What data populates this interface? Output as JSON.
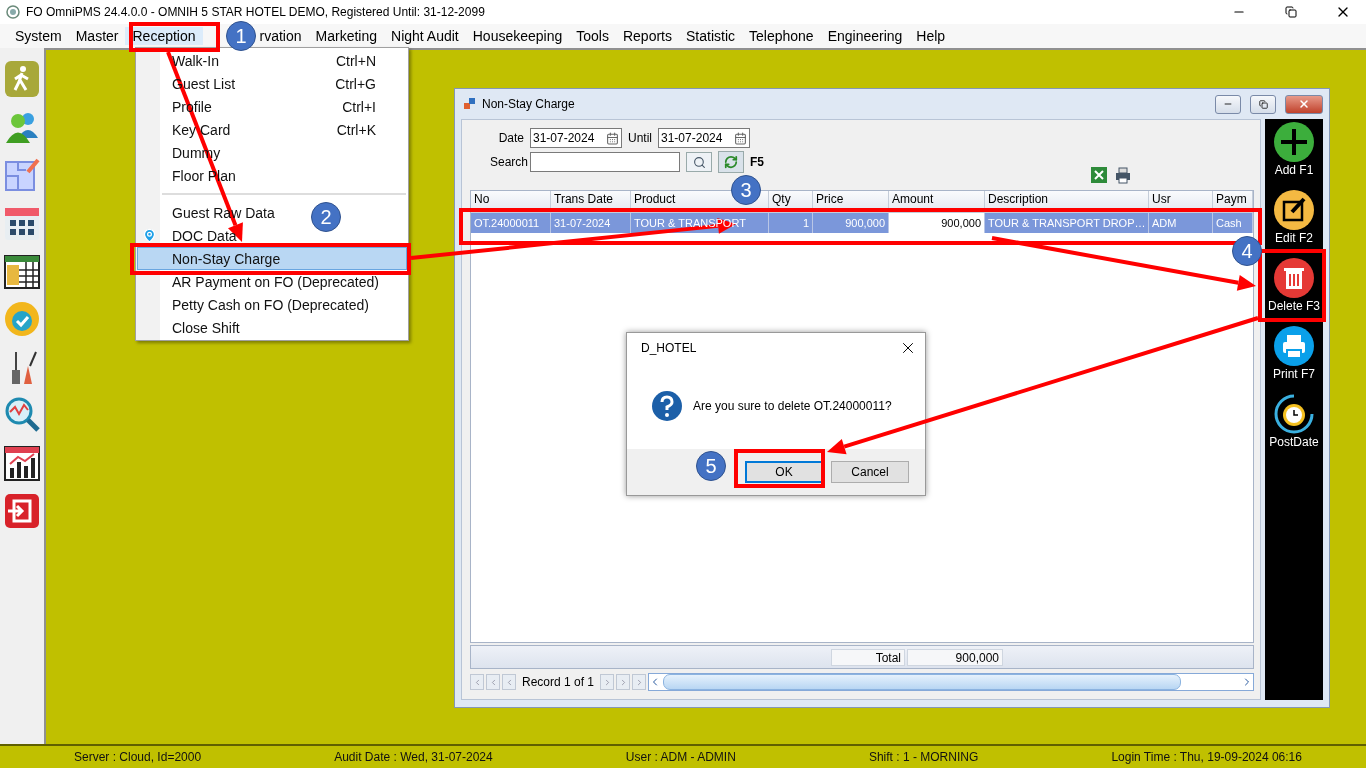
{
  "window": {
    "title": "FO OmniPMS 24.4.0.0 - OMNIH 5 STAR HOTEL DEMO, Registered Until: 31-12-2099"
  },
  "menu_bar": [
    {
      "label": "System",
      "selected": false
    },
    {
      "label": "Master",
      "selected": false
    },
    {
      "label": "Reception",
      "selected": true
    },
    {
      "label": "rvation",
      "selected": false
    },
    {
      "label": "Marketing",
      "selected": false
    },
    {
      "label": "Night Audit",
      "selected": false
    },
    {
      "label": "Housekeeping",
      "selected": false
    },
    {
      "label": "Tools",
      "selected": false
    },
    {
      "label": "Reports",
      "selected": false
    },
    {
      "label": "Statistic",
      "selected": false
    },
    {
      "label": "Telephone",
      "selected": false
    },
    {
      "label": "Engineering",
      "selected": false
    },
    {
      "label": "Help",
      "selected": false
    }
  ],
  "reception_menu": {
    "sections": [
      [
        {
          "label": "Walk-In",
          "shortcut": "Ctrl+N",
          "selected": false
        },
        {
          "label": "Guest List",
          "shortcut": "Ctrl+G",
          "selected": false
        },
        {
          "label": "Profile",
          "shortcut": "Ctrl+I",
          "selected": false
        },
        {
          "label": "Key Card",
          "shortcut": "Ctrl+K",
          "selected": false
        },
        {
          "label": "Dummy",
          "selected": false
        },
        {
          "label": "Floor Plan",
          "selected": false
        }
      ],
      [
        {
          "label": "Guest Raw Data",
          "selected": false
        },
        {
          "label": "DOC Data",
          "kind": "pin",
          "selected": false
        },
        {
          "label": "Non-Stay Charge",
          "selected": true
        },
        {
          "label": "AR Payment on FO (Deprecated)",
          "selected": false
        },
        {
          "label": "Petty Cash on FO (Deprecated)",
          "selected": false
        },
        {
          "label": "Close Shift",
          "selected": false
        }
      ]
    ]
  },
  "non_stay_window": {
    "title": "Non-Stay Charge",
    "date_label": "Date",
    "date": "31-07-2024",
    "until_label": "Until",
    "until": "31-07-2024",
    "search_label": "Search",
    "refresh_key": "F5",
    "table": {
      "columns": [
        "No",
        "Trans Date",
        "Product",
        "Qty",
        "Price",
        "Amount",
        "Description",
        "Usr",
        "Paym"
      ],
      "rows": [
        {
          "cells": [
            "OT.24000011",
            "31-07-2024",
            "TOUR & TRANSPORT",
            "1",
            "900,000",
            "900,000",
            "TOUR & TRANSPORT DROP…",
            "ADM",
            "Cash"
          ],
          "selected": true
        }
      ]
    },
    "total_label": "Total",
    "total": "900,000",
    "record": "Record 1 of 1"
  },
  "toolbar": [
    {
      "label": "Add F1",
      "kind": "add"
    },
    {
      "label": "Edit F2",
      "kind": "edit"
    },
    {
      "label": "Delete F3",
      "kind": "delete"
    },
    {
      "label": "Print F7",
      "kind": "print"
    },
    {
      "label": "PostDate",
      "kind": "postdate"
    }
  ],
  "dialog": {
    "title": "D_HOTEL",
    "message": "Are you sure to delete OT.24000011?",
    "buttons": [
      {
        "label": "OK",
        "selected": true
      },
      {
        "label": "Cancel",
        "selected": false
      }
    ]
  },
  "status_bar": [
    "Server : Cloud, Id=2000",
    "Audit Date : Wed, 31-07-2024",
    "User : ADM - ADMIN",
    "Shift : 1 - MORNING",
    "Login Time : Thu, 19-09-2024 06:16"
  ],
  "steps": [
    "1",
    "2",
    "3",
    "4",
    "5"
  ]
}
